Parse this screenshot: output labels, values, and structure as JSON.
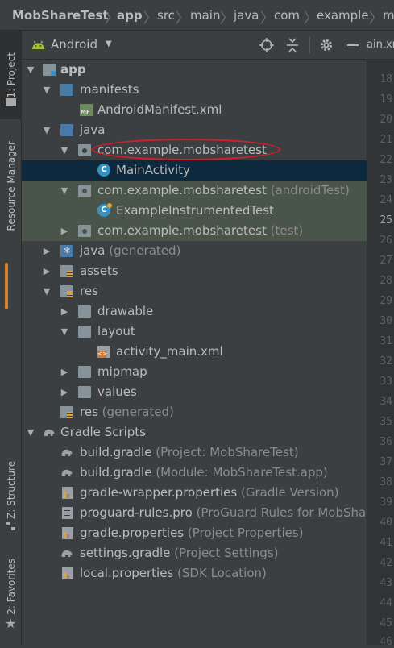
{
  "breadcrumbs": [
    "MobShareTest",
    "app",
    "src",
    "main",
    "java",
    "com",
    "example",
    "m"
  ],
  "left_tool_tabs": {
    "project": "1: Project",
    "resource_manager": "Resource Manager",
    "structure": "Z: Structure",
    "favorites": "2: Favorites"
  },
  "project_view": {
    "view_mode": "Android"
  },
  "editor_tab_label": "ain.xn",
  "tree": [
    {
      "label": "app",
      "suffix": ""
    },
    {
      "label": "manifests",
      "suffix": ""
    },
    {
      "label": "AndroidManifest.xml",
      "suffix": ""
    },
    {
      "label": "java",
      "suffix": ""
    },
    {
      "label": "com.example.mobsharetest",
      "suffix": ""
    },
    {
      "label": "MainActivity",
      "suffix": ""
    },
    {
      "label": "com.example.mobsharetest",
      "suffix": "(androidTest)"
    },
    {
      "label": "ExampleInstrumentedTest",
      "suffix": ""
    },
    {
      "label": "com.example.mobsharetest",
      "suffix": "(test)"
    },
    {
      "label": "java",
      "suffix": "(generated)"
    },
    {
      "label": "assets",
      "suffix": ""
    },
    {
      "label": "res",
      "suffix": ""
    },
    {
      "label": "drawable",
      "suffix": ""
    },
    {
      "label": "layout",
      "suffix": ""
    },
    {
      "label": "activity_main.xml",
      "suffix": ""
    },
    {
      "label": "mipmap",
      "suffix": ""
    },
    {
      "label": "values",
      "suffix": ""
    },
    {
      "label": "res",
      "suffix": "(generated)"
    },
    {
      "label": "Gradle Scripts",
      "suffix": ""
    },
    {
      "label": "build.gradle",
      "suffix": "(Project: MobShareTest)"
    },
    {
      "label": "build.gradle",
      "suffix": "(Module: MobShareTest.app)"
    },
    {
      "label": "gradle-wrapper.properties",
      "suffix": "(Gradle Version)"
    },
    {
      "label": "proguard-rules.pro",
      "suffix": "(ProGuard Rules for MobShar"
    },
    {
      "label": "gradle.properties",
      "suffix": "(Project Properties)"
    },
    {
      "label": "settings.gradle",
      "suffix": "(Project Settings)"
    },
    {
      "label": "local.properties",
      "suffix": "(SDK Location)"
    }
  ],
  "line_numbers": [
    "18",
    "19",
    "20",
    "21",
    "22",
    "23",
    "24",
    "25",
    "26",
    "27",
    "28",
    "29",
    "30",
    "31",
    "32",
    "33",
    "34",
    "35",
    "36",
    "37",
    "38",
    "39",
    "40",
    "41",
    "42",
    "43",
    "44",
    "45",
    "46"
  ],
  "colors": {
    "panel_bg": "#3c3f41",
    "selection": "#0d293e",
    "test_highlight": "#49544a",
    "annotation_circle": "#d0212a",
    "android_green": "#a4c639",
    "class_icon_blue": "#3592c4"
  }
}
